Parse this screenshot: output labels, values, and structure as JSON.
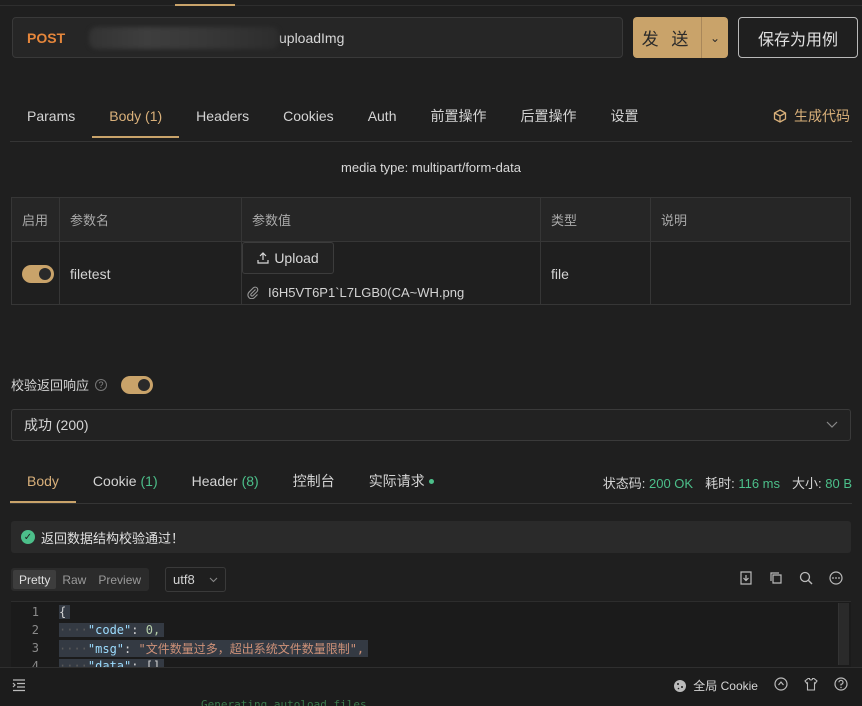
{
  "request": {
    "method": "POST",
    "url_path": "uploadImg",
    "send_label": "发 送",
    "save_label": "保存为用例"
  },
  "request_tabs": [
    {
      "label": "Params"
    },
    {
      "label": "Body",
      "count": "(1)"
    },
    {
      "label": "Headers"
    },
    {
      "label": "Cookies"
    },
    {
      "label": "Auth"
    },
    {
      "label": "前置操作"
    },
    {
      "label": "后置操作"
    },
    {
      "label": "设置"
    }
  ],
  "generate_code_label": "生成代码",
  "media_type_label": "media type: multipart/form-data",
  "params_table": {
    "headers": [
      "启用",
      "参数名",
      "参数值",
      "类型",
      "说明"
    ],
    "row": {
      "enabled": true,
      "name": "filetest",
      "upload_label": "Upload",
      "file_name": "I6H5VT6P1`L7LGB0(CA~WH.png",
      "type": "file",
      "description": ""
    }
  },
  "validate": {
    "label": "校验返回响应",
    "enabled": true,
    "status_option": "成功 (200)"
  },
  "response_tabs": [
    {
      "label": "Body"
    },
    {
      "label": "Cookie",
      "count": "(1)"
    },
    {
      "label": "Header",
      "count": "(8)"
    },
    {
      "label": "控制台"
    },
    {
      "label": "实际请求"
    }
  ],
  "response_meta": {
    "status_label": "状态码:",
    "status_value": "200 OK",
    "time_label": "耗时:",
    "time_value": "116 ms",
    "size_label": "大小:",
    "size_value": "80 B"
  },
  "validate_ok_message": "返回数据结构校验通过！",
  "format_options": [
    "Pretty",
    "Raw",
    "Preview"
  ],
  "encoding": "utf8",
  "code_lines": [
    {
      "num": "1",
      "text": "{"
    },
    {
      "num": "2",
      "key": "\"code\"",
      "value": "0,"
    },
    {
      "num": "3",
      "key": "\"msg\"",
      "value": "\"文件数量过多，超出系统文件数量限制\","
    },
    {
      "num": "4",
      "key": "\"data\"",
      "value": "[]"
    }
  ],
  "status_bar": {
    "cookie_label": "全局 Cookie",
    "underlay_text": "Generating autoload files"
  },
  "colors": {
    "accent": "#c9a36a",
    "method": "#e5863b",
    "success": "#4cbf8a",
    "background": "#1f1f1f"
  }
}
